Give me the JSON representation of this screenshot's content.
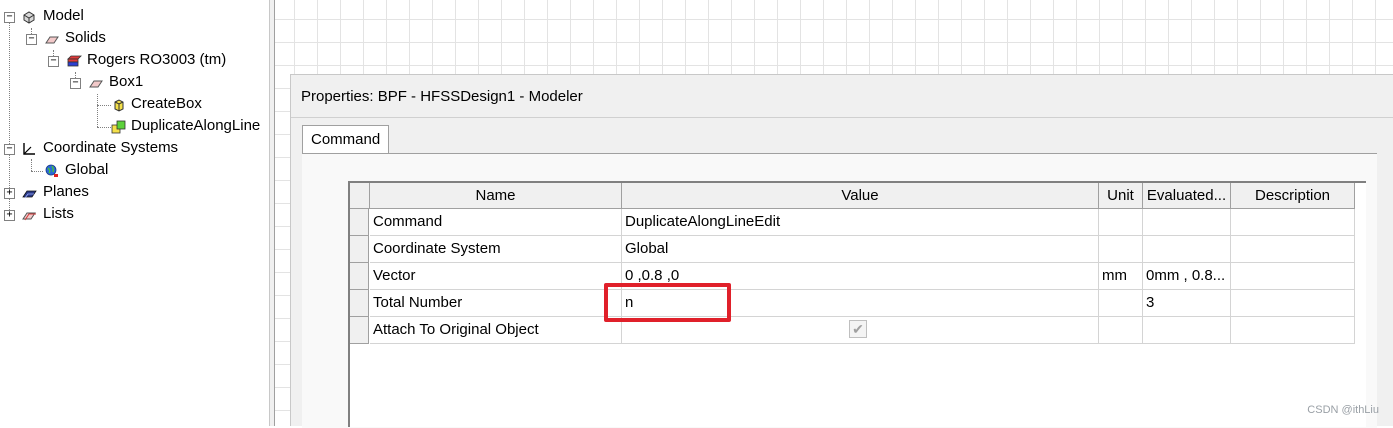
{
  "tree": {
    "root": "Model",
    "solids": "Solids",
    "material": "Rogers RO3003 (tm)",
    "box": "Box1",
    "create_box": "CreateBox",
    "duplicate": "DuplicateAlongLine",
    "coord_systems": "Coordinate Systems",
    "global": "Global",
    "planes": "Planes",
    "lists": "Lists",
    "expanded_symbol": "−",
    "collapsed_symbol": "+"
  },
  "properties": {
    "title": "Properties: BPF - HFSSDesign1 - Modeler",
    "tab_label": "Command",
    "columns": [
      "Name",
      "Value",
      "Unit",
      "Evaluated...",
      "Description"
    ],
    "rows": [
      {
        "name": "Command",
        "value": "DuplicateAlongLineEdit",
        "unit": "",
        "evaluated": "",
        "description": ""
      },
      {
        "name": "Coordinate System",
        "value": "Global",
        "unit": "",
        "evaluated": "",
        "description": ""
      },
      {
        "name": "Vector",
        "value": "0 ,0.8 ,0",
        "unit": "mm",
        "evaluated": "0mm , 0.8...",
        "description": ""
      },
      {
        "name": "Total Number",
        "value": "n",
        "unit": "",
        "evaluated": "3",
        "description": ""
      },
      {
        "name": "Attach To Original Object",
        "value": "",
        "unit": "",
        "evaluated": "",
        "description": ""
      }
    ],
    "attach_checked": true,
    "checkmark": "✔"
  },
  "highlight_color": "#e0202a",
  "watermark": "CSDN @ithLiu"
}
